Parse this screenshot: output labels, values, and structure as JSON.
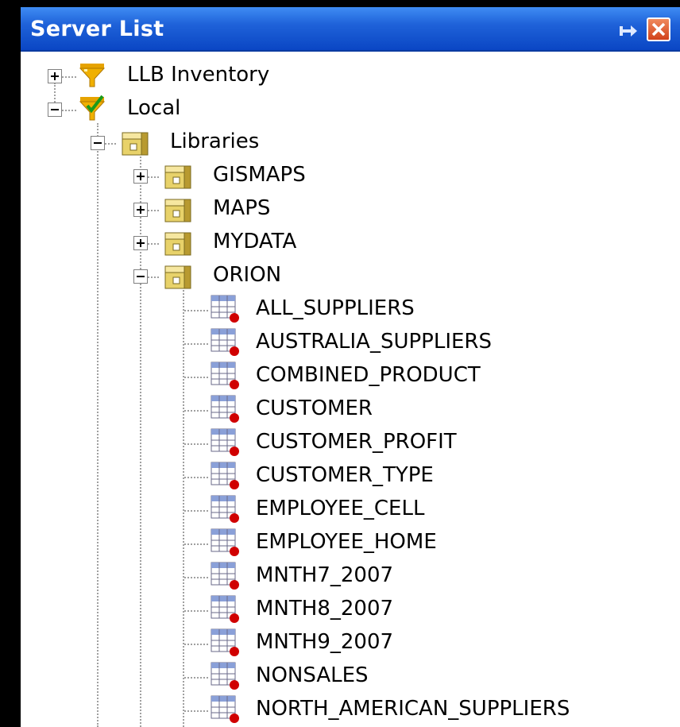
{
  "panel": {
    "title": "Server List"
  },
  "tree": {
    "servers": [
      {
        "label": "LLB Inventory",
        "expanded": false
      },
      {
        "label": "Local",
        "expanded": true
      }
    ],
    "libraries_label": "Libraries",
    "libraries": [
      {
        "label": "GISMAPS",
        "expanded": false
      },
      {
        "label": "MAPS",
        "expanded": false
      },
      {
        "label": "MYDATA",
        "expanded": false
      },
      {
        "label": "ORION",
        "expanded": true
      }
    ],
    "tables": [
      "ALL_SUPPLIERS",
      "AUSTRALIA_SUPPLIERS",
      "COMBINED_PRODUCT",
      "CUSTOMER",
      "CUSTOMER_PROFIT",
      "CUSTOMER_TYPE",
      "EMPLOYEE_CELL",
      "EMPLOYEE_HOME",
      "MNTH7_2007",
      "MNTH8_2007",
      "MNTH9_2007",
      "NONSALES",
      "NORTH_AMERICAN_SUPPLIERS"
    ]
  },
  "icons": {
    "server_funnel": "funnel-icon",
    "server_connected": "funnel-check-icon",
    "library": "library-icon",
    "table": "table-icon"
  },
  "colors": {
    "title_bar": "#1f62d9",
    "close_button": "#d1411a",
    "funnel": "#f0b000",
    "check": "#1a9a1a",
    "library": "#e8d26a",
    "table_badge": "#d00000"
  }
}
